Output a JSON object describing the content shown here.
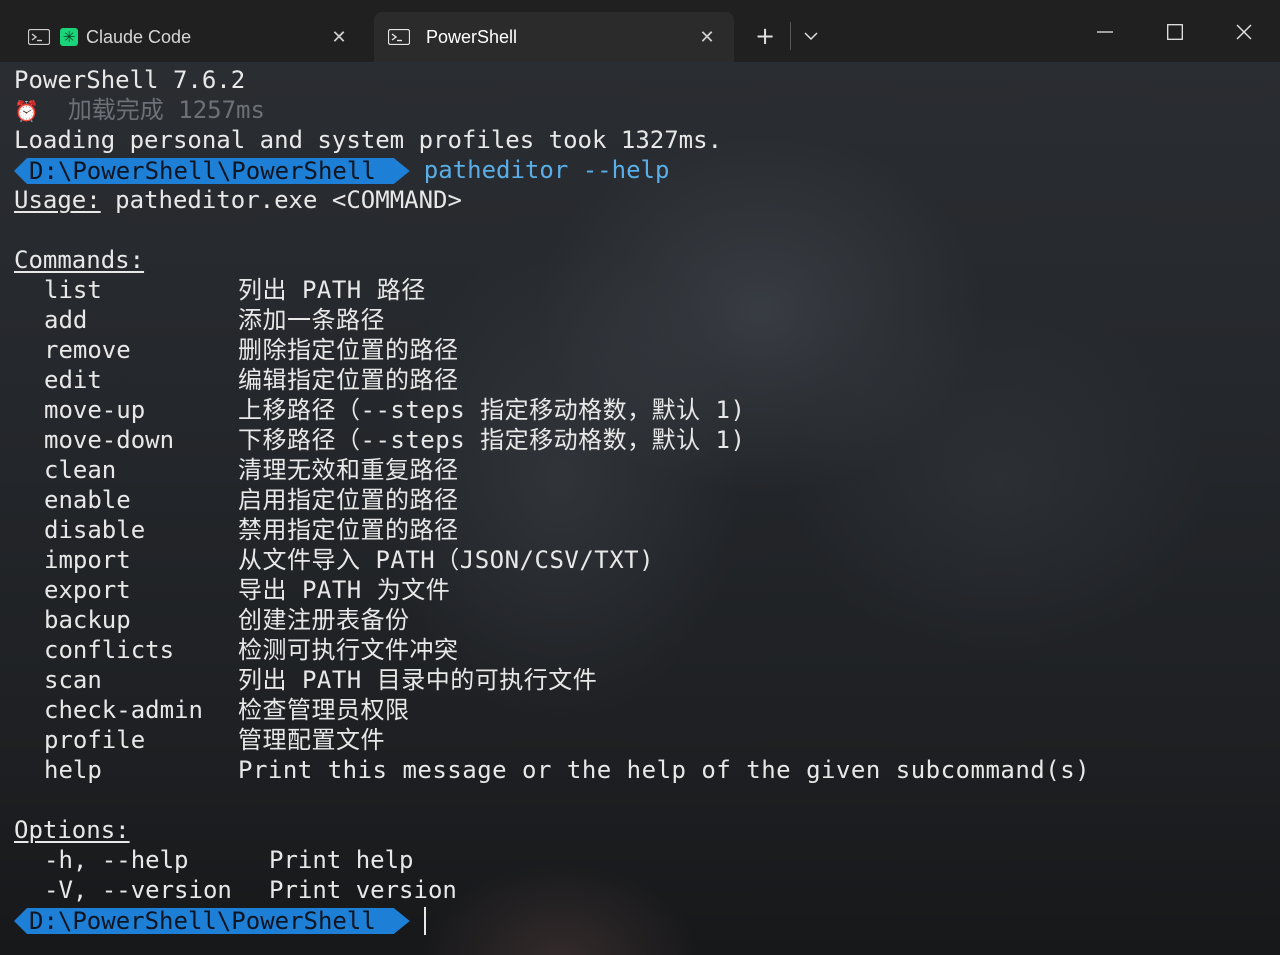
{
  "tabs": [
    {
      "label": "Claude Code",
      "active": false,
      "icon": "terminal-icon"
    },
    {
      "label": "PowerShell",
      "active": true,
      "icon": "terminal-icon"
    }
  ],
  "window_buttons": {
    "new_tab": "+",
    "dropdown": "chevron-down-icon"
  },
  "terminal": {
    "version_line": "PowerShell 7.6.2",
    "load_time": "加载完成 1257ms",
    "profile_line": "Loading personal and system profiles took 1327ms.",
    "prompt_path": "D:\\PowerShell\\PowerShell",
    "typed_command": "patheditor --help",
    "usage_label": "Usage:",
    "usage_text": " patheditor.exe <COMMAND>",
    "commands_heading": "Commands:",
    "commands": [
      {
        "name": "list",
        "desc": "列出 PATH 路径"
      },
      {
        "name": "add",
        "desc": "添加一条路径"
      },
      {
        "name": "remove",
        "desc": "删除指定位置的路径"
      },
      {
        "name": "edit",
        "desc": "编辑指定位置的路径"
      },
      {
        "name": "move-up",
        "desc": "上移路径（--steps 指定移动格数，默认 1)"
      },
      {
        "name": "move-down",
        "desc": "下移路径（--steps 指定移动格数，默认 1)"
      },
      {
        "name": "clean",
        "desc": "清理无效和重复路径"
      },
      {
        "name": "enable",
        "desc": "启用指定位置的路径"
      },
      {
        "name": "disable",
        "desc": "禁用指定位置的路径"
      },
      {
        "name": "import",
        "desc": "从文件导入 PATH（JSON/CSV/TXT)"
      },
      {
        "name": "export",
        "desc": "导出 PATH 为文件"
      },
      {
        "name": "backup",
        "desc": "创建注册表备份"
      },
      {
        "name": "conflicts",
        "desc": "检测可执行文件冲突"
      },
      {
        "name": "scan",
        "desc": "列出 PATH 目录中的可执行文件"
      },
      {
        "name": "check-admin",
        "desc": "检查管理员权限"
      },
      {
        "name": "profile",
        "desc": "管理配置文件"
      },
      {
        "name": "help",
        "desc": "Print this message or the help of the given subcommand(s)"
      }
    ],
    "options_heading": "Options:",
    "options": [
      {
        "name": "-h, --help",
        "desc": "Print help"
      },
      {
        "name": "-V, --version",
        "desc": "Print version"
      }
    ],
    "prompt_path_2": "D:\\PowerShell\\PowerShell"
  },
  "colors": {
    "prompt_bg": "#1e7fd6",
    "typed_command": "#5aaee8",
    "claude_icon": "#1bd47a"
  }
}
